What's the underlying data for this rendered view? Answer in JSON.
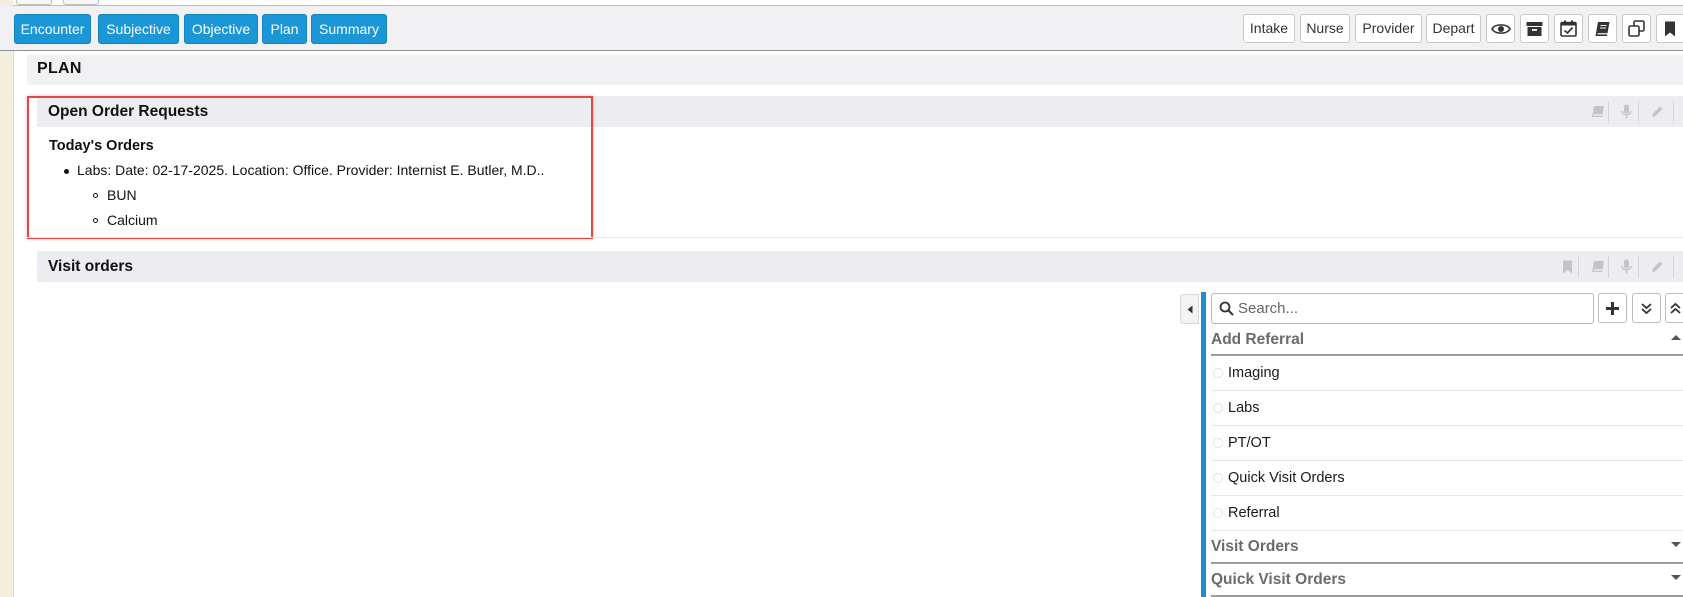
{
  "toolbar": {
    "tabs": [
      "Encounter",
      "Subjective",
      "Objective",
      "Plan",
      "Summary"
    ],
    "roles": [
      "Intake",
      "Nurse",
      "Provider",
      "Depart"
    ],
    "tool_icons": [
      "eye-icon",
      "archive-icon",
      "calendar-check-icon",
      "book-icon",
      "copy-icon",
      "bookmark-icon"
    ],
    "accent_color": "#1b96d6"
  },
  "plan": {
    "title": "PLAN"
  },
  "open_orders": {
    "title": "Open Order Requests",
    "subtitle": "Today's Orders",
    "order_line": "Labs: Date: 02-17-2025. Location: Office. Provider: Internist E. Butler, M.D..",
    "tests": [
      "BUN",
      "Calcium"
    ]
  },
  "visit_orders_section": {
    "title": "Visit orders"
  },
  "order_panel": {
    "search_placeholder": "Search...",
    "groups": [
      {
        "title": "Add Referral",
        "expanded": true,
        "items": [
          "Imaging",
          "Labs",
          "PT/OT",
          "Quick Visit Orders",
          "Referral"
        ]
      },
      {
        "title": "Visit Orders",
        "expanded": false
      },
      {
        "title": "Quick Visit Orders",
        "expanded": false
      }
    ]
  }
}
